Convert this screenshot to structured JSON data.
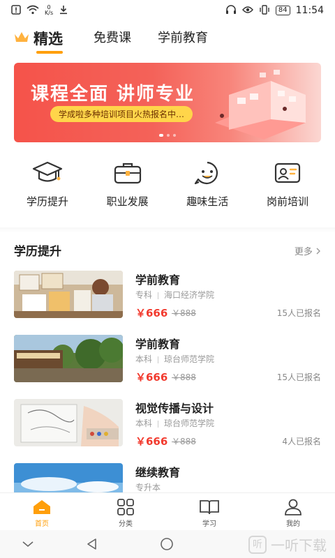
{
  "status_bar": {
    "net_speed_value": "0",
    "net_speed_unit": "K/s",
    "battery": "84",
    "time": "11:54"
  },
  "tabs": [
    {
      "label": "精选",
      "active": true
    },
    {
      "label": "免费课",
      "active": false
    },
    {
      "label": "学前教育",
      "active": false
    }
  ],
  "banner": {
    "title": "课程全面 讲师专业",
    "subtitle": "学成啦多种培训项目火热报名中…",
    "dot_count": 3,
    "active_dot": 0
  },
  "categories": [
    {
      "label": "学历提升",
      "icon": "graduation-cap-icon"
    },
    {
      "label": "职业发展",
      "icon": "briefcase-icon"
    },
    {
      "label": "趣味生活",
      "icon": "smiley-icon"
    },
    {
      "label": "岗前培训",
      "icon": "id-card-icon"
    }
  ],
  "section": {
    "title": "学历提升",
    "more": "更多"
  },
  "courses": [
    {
      "title": "学前教育",
      "level": "专科",
      "school": "海口经济学院",
      "price": "￥666",
      "original_price": "￥888",
      "enrolled": "15人已报名",
      "thumb": "art-class"
    },
    {
      "title": "学前教育",
      "level": "本科",
      "school": "琼台师范学院",
      "price": "￥666",
      "original_price": "￥888",
      "enrolled": "15人已报名",
      "thumb": "train-forest"
    },
    {
      "title": "视觉传播与设计",
      "level": "本科",
      "school": "琼台师范学院",
      "price": "￥666",
      "original_price": "￥888",
      "enrolled": "4人已报名",
      "thumb": "drawing"
    },
    {
      "title": "继续教育",
      "level": "专升本",
      "school": "",
      "price": "",
      "original_price": "",
      "enrolled": "",
      "thumb": "sky"
    }
  ],
  "bottom_nav": [
    {
      "label": "首页",
      "icon": "home-icon",
      "active": true
    },
    {
      "label": "分类",
      "icon": "grid-icon",
      "active": false
    },
    {
      "label": "学习",
      "icon": "book-icon",
      "active": false
    },
    {
      "label": "我的",
      "icon": "person-icon",
      "active": false
    }
  ],
  "watermark": {
    "text": "一听下载",
    "logo_glyph": "听"
  },
  "colors": {
    "accent": "#ff9f0a",
    "price": "#f23b2f",
    "banner": "#f5534a"
  }
}
